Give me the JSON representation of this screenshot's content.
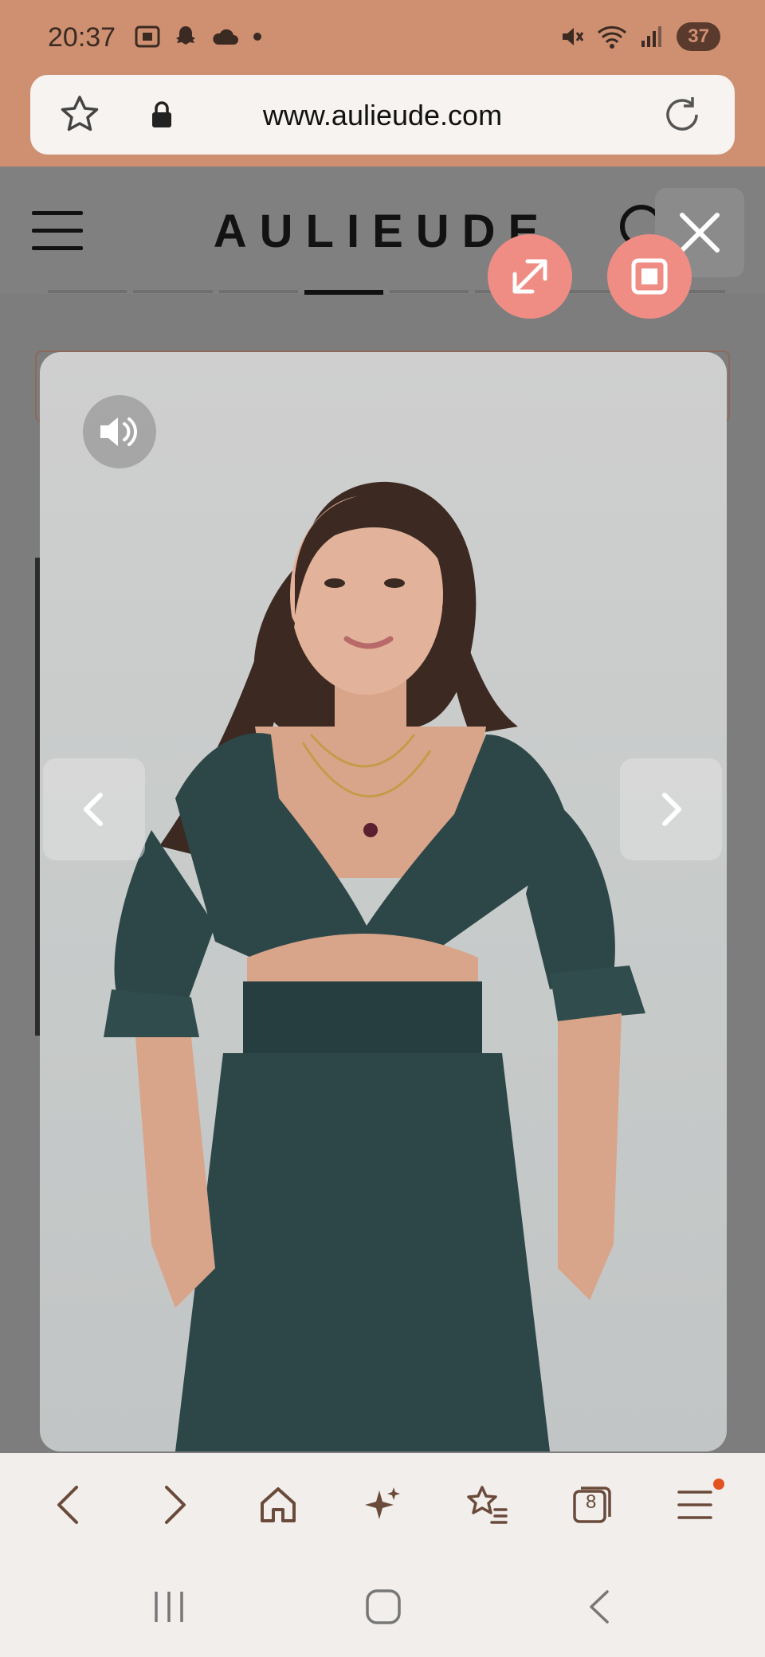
{
  "status_bar": {
    "time": "20:37",
    "battery": "37",
    "left_icons": [
      "screenshot-icon",
      "snapchat-icon",
      "cloud-icon",
      "dot-icon"
    ],
    "right_icons": [
      "mute-icon",
      "wifi-icon",
      "signal-icon"
    ]
  },
  "browser": {
    "url": "www.aulieude.com",
    "tab_count": "8"
  },
  "site": {
    "brand": "AULIEUDE"
  },
  "colors": {
    "status_bar_bg": "#cf9072",
    "accent_pink": "#ef8d84",
    "toolbar_icon": "#6a4a3a"
  },
  "toolbar": {
    "items": [
      "back-icon",
      "forward-icon",
      "home-icon",
      "sparkle-icon",
      "bookmark-star-icon",
      "tabs-icon",
      "menu-icon"
    ]
  }
}
